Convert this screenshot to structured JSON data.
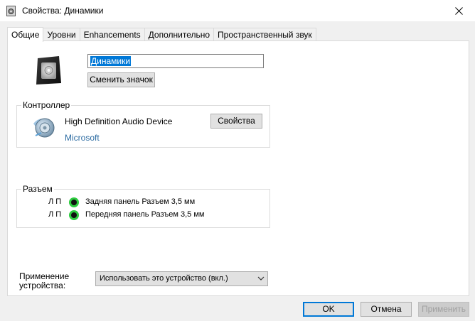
{
  "window": {
    "title": "Свойства: Динамики",
    "close_icon": "close-icon"
  },
  "tabs": [
    {
      "label": "Общие",
      "active": true
    },
    {
      "label": "Уровни",
      "active": false
    },
    {
      "label": "Enhancements",
      "active": false
    },
    {
      "label": "Дополнительно",
      "active": false
    },
    {
      "label": "Пространственный звук",
      "active": false
    }
  ],
  "device": {
    "icon": "speaker-icon",
    "name_value": "Динамики",
    "change_icon_label": "Сменить значок"
  },
  "controller": {
    "group_label": "Контроллер",
    "icon": "audio-device-icon",
    "device_name": "High Definition Audio Device",
    "vendor": "Microsoft",
    "properties_label": "Свойства"
  },
  "jack": {
    "group_label": "Разъем",
    "rows": [
      {
        "channels": "Л П",
        "text": "Задняя панель Разъем 3,5 мм",
        "color": "#2ecc40"
      },
      {
        "channels": "Л П",
        "text": "Передняя панель Разъем 3,5 мм",
        "color": "#2ecc40"
      }
    ]
  },
  "usage": {
    "label_line1": "Применение",
    "label_line2": "устройства:",
    "selected": "Использовать это устройство (вкл.)"
  },
  "buttons": {
    "ok": "OK",
    "cancel": "Отмена",
    "apply": "Применить"
  },
  "colors": {
    "accent": "#0078d7",
    "link": "#2d6ca2",
    "jack_green": "#2ecc40"
  }
}
